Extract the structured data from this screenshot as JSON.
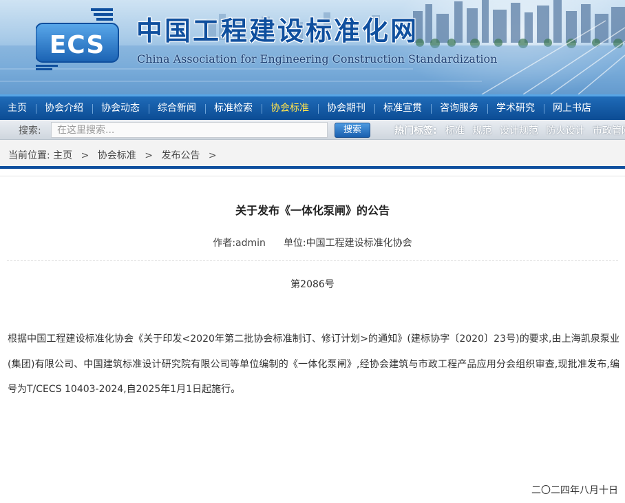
{
  "header": {
    "title_cn": "中国工程建设标准化网",
    "title_en": "China Association for Engineering Construction Standardization",
    "logo_text": "ECS"
  },
  "nav": {
    "items": [
      "主页",
      "协会介绍",
      "协会动态",
      "综合新闻",
      "标准检索",
      "协会标准",
      "协会期刊",
      "标准宣贯",
      "咨询服务",
      "学术研究",
      "网上书店"
    ],
    "active": "协会标准"
  },
  "search": {
    "label": "搜索:",
    "placeholder": "在这里搜索...",
    "button": "搜索",
    "hot_label": "热门标签:",
    "hot_tags": [
      "标准",
      "规范",
      "设计规范",
      "防火设计",
      "市政管网"
    ]
  },
  "breadcrumb": {
    "prefix": "当前位置:",
    "items": [
      "主页",
      "协会标准",
      "发布公告"
    ],
    "separator": ">"
  },
  "article": {
    "title": "关于发布《一体化泵闸》的公告",
    "author": "作者:admin",
    "unit": "单位:中国工程建设标准化协会",
    "doc_no": "第2086号",
    "body": "根据中国工程建设标准化协会《关于印发<2020年第二批协会标准制订、修订计划>的通知》(建标协字〔2020〕23号)的要求,由上海凯泉泵业(集团)有限公司、中国建筑标准设计研究院有限公司等单位编制的《一体化泵闸》,经协会建筑与市政工程产品应用分会组织审查,现批准发布,编号为T/CECS 10403-2024,自2025年1月1日起施行。",
    "date": "二〇二四年八月十日"
  },
  "colors": {
    "nav_bg": "#0c4c94",
    "nav_active": "#ffe34d",
    "brand_blue": "#0f4f9e"
  }
}
